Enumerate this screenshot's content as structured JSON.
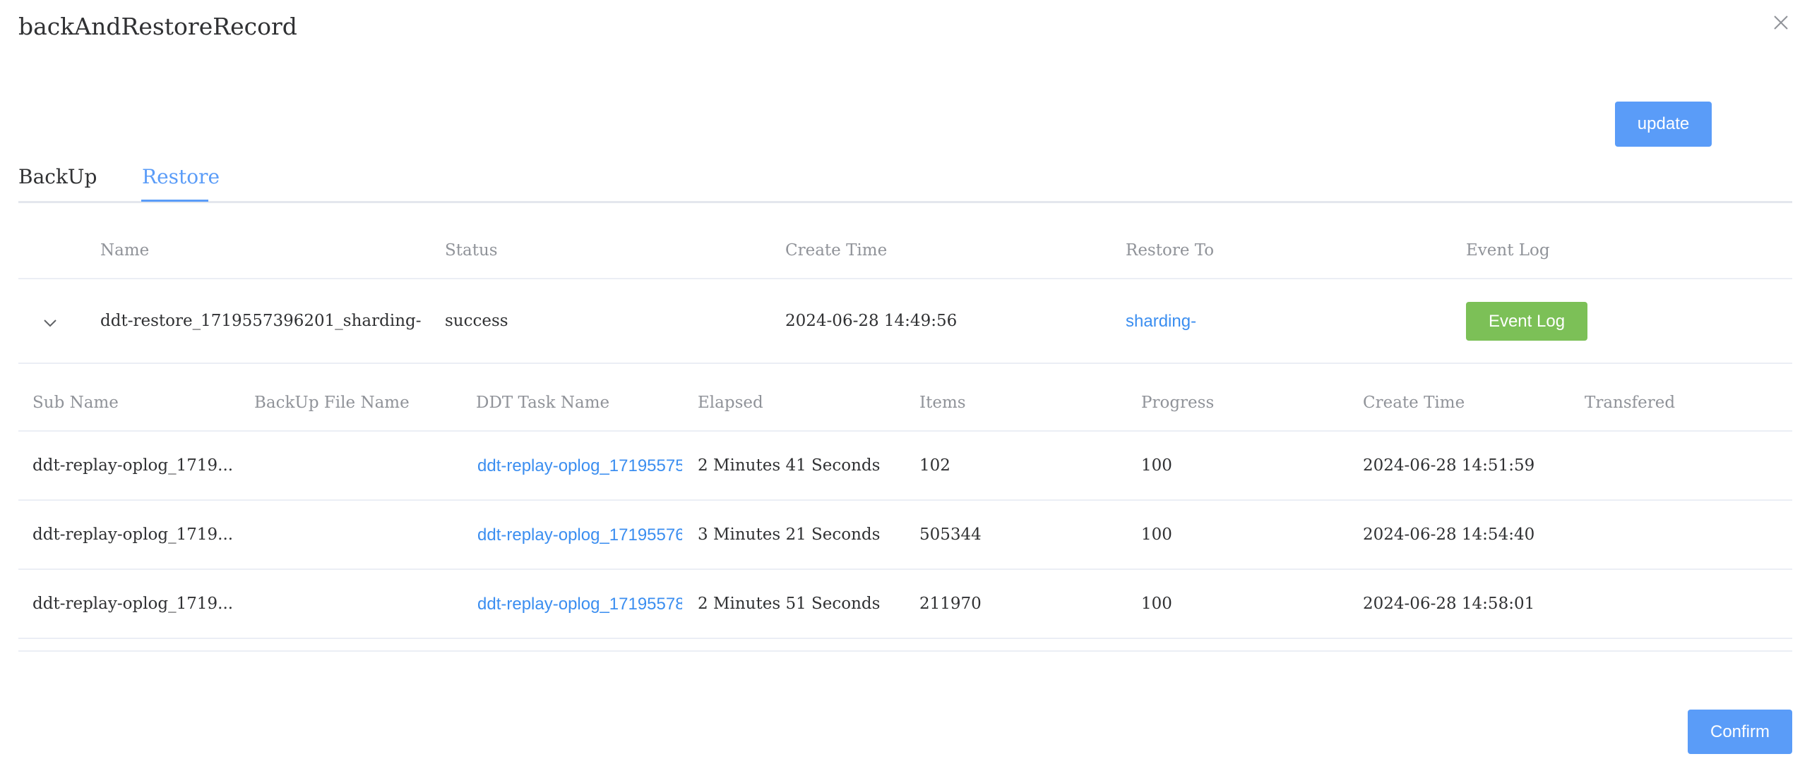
{
  "dialog": {
    "title": "backAndRestoreRecord",
    "update_label": "update",
    "confirm_label": "Confirm"
  },
  "tabs": [
    {
      "label": "BackUp",
      "active": false
    },
    {
      "label": "Restore",
      "active": true
    }
  ],
  "main_table": {
    "headers": [
      "Name",
      "Status",
      "Create Time",
      "Restore To",
      "Event Log"
    ],
    "rows": [
      {
        "name": "ddt-restore_1719557396201_sharding-",
        "status": "success",
        "create_time": "2024-06-28 14:49:56",
        "restore_to": "sharding-",
        "event_log_label": "Event Log"
      }
    ]
  },
  "sub_table": {
    "headers": [
      "Sub Name",
      "BackUp File Name",
      "DDT Task Name",
      "Elapsed",
      "Items",
      "Progress",
      "Create Time",
      "Transfered"
    ],
    "rows": [
      {
        "sub_name": "ddt-replay-oplog_1719...",
        "backup_file": "",
        "ddt_task": "ddt-replay-oplog_17195575",
        "elapsed": "2 Minutes 41 Seconds",
        "items": "102",
        "progress": "100",
        "create_time": "2024-06-28 14:51:59",
        "transfered": ""
      },
      {
        "sub_name": "ddt-replay-oplog_1719...",
        "backup_file": "",
        "ddt_task": "ddt-replay-oplog_17195576",
        "elapsed": "3 Minutes 21 Seconds",
        "items": "505344",
        "progress": "100",
        "create_time": "2024-06-28 14:54:40",
        "transfered": ""
      },
      {
        "sub_name": "ddt-replay-oplog_1719...",
        "backup_file": "",
        "ddt_task": "ddt-replay-oplog_17195578",
        "elapsed": "2 Minutes 51 Seconds",
        "items": "211970",
        "progress": "100",
        "create_time": "2024-06-28 14:58:01",
        "transfered": ""
      }
    ]
  },
  "colors": {
    "primary": "#5a9cf8",
    "success": "#7cc057",
    "link": "#3b8ef0",
    "header_text": "#909399",
    "body_text": "#303133",
    "divider": "#ebeef5"
  },
  "icons": {
    "close": "close-icon",
    "expand": "chevron-down-icon"
  }
}
